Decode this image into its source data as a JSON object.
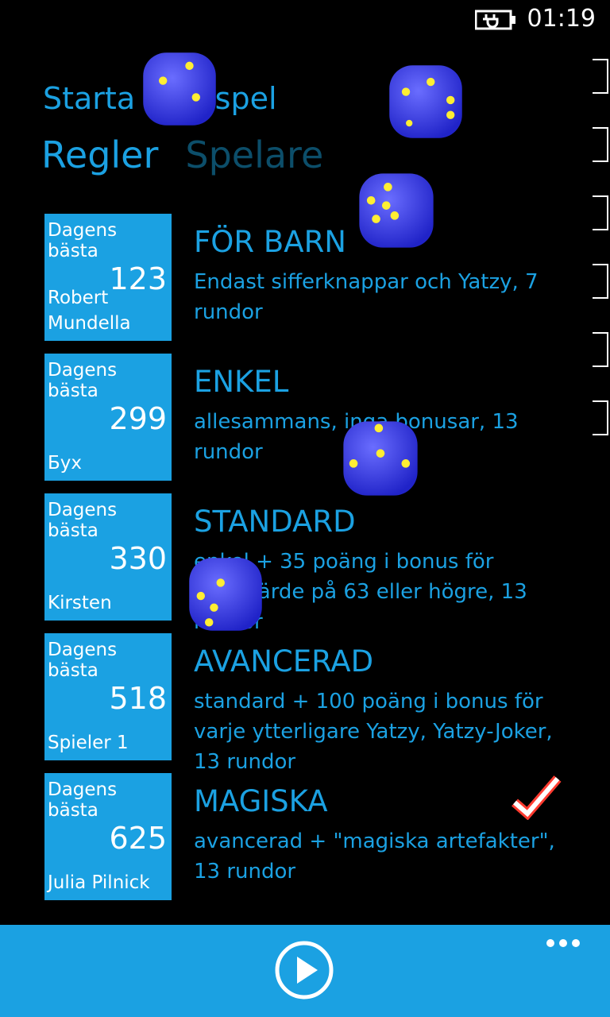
{
  "status": {
    "time": "01:19",
    "battery_icon": "battery-charging-icon"
  },
  "app_title": "Starta nytt spel",
  "pivot": {
    "tabs": [
      "Regler",
      "Spelare"
    ],
    "active": "Regler"
  },
  "rows": [
    {
      "tile_label": "Dagens bästa",
      "score": "123",
      "player": "Robert Mundella",
      "mode": "FÖR BARN",
      "description": "Endast sifferknappar och Yatzy, 7 rundor"
    },
    {
      "tile_label": "Dagens bästa",
      "score": "299",
      "player": "Бух",
      "mode": "ENKEL",
      "description": "allesammans, inga bonusar, 13 rundor"
    },
    {
      "tile_label": "Dagens bästa",
      "score": "330",
      "player": "Kirsten",
      "mode": "STANDARD",
      "description": "enkel + 35 poäng i bonus för siffervärde på 63 eller högre, 13 rundor"
    },
    {
      "tile_label": "Dagens bästa",
      "score": "518",
      "player": "Spieler 1",
      "mode": "AVANCERAD",
      "description": "standard + 100 poäng i bonus för varje ytterligare Yatzy, Yatzy-Joker, 13 rundor"
    },
    {
      "tile_label": "Dagens bästa",
      "score": "625",
      "player": "Julia Pilnick",
      "mode": "MAGISKA",
      "description": "avancerad + \"magiska artefakter\", 13 rundor",
      "selected": true
    }
  ],
  "appbar": {
    "play_icon": "play-icon",
    "more_icon": "more-icon"
  },
  "colors": {
    "accent": "#1ba1e2",
    "inactive_tab": "#0c4e6a",
    "dice": "#3a3df0",
    "dice_pips": "#ffee33"
  }
}
